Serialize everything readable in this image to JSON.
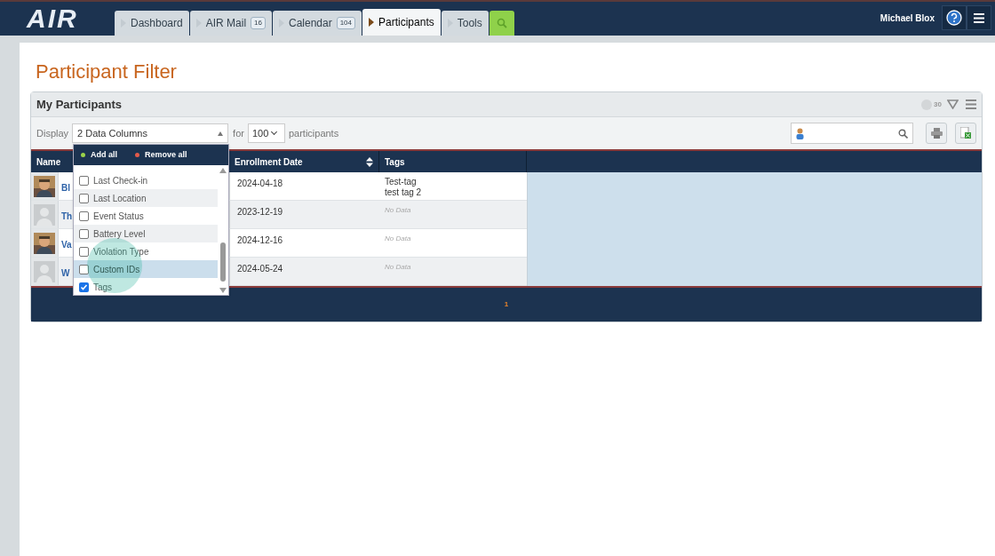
{
  "top_bar": {
    "logo": "AIR",
    "tabs": [
      {
        "label": "Dashboard",
        "selected": false
      },
      {
        "label": "AIR Mail",
        "badge": "16",
        "selected": false
      },
      {
        "label": "Calendar",
        "badge": "104",
        "selected": false
      },
      {
        "label": "Participants",
        "selected": true
      },
      {
        "label": "Tools",
        "selected": false
      }
    ],
    "user": "Michael Blox"
  },
  "page_title": "Participant Filter",
  "panel": {
    "title": "My Participants",
    "count": "30",
    "toolbar": {
      "display_label": "Display",
      "columns_select": "2 Data Columns",
      "for_label": "for",
      "per_page": "100",
      "per_page_label": "participants"
    },
    "columns_dropdown": {
      "actions": [
        {
          "label": "Add all",
          "kind": "add"
        },
        {
          "label": "Remove all",
          "kind": "remove"
        }
      ],
      "options": [
        {
          "label": "Last Check-in",
          "checked": false,
          "selected": false
        },
        {
          "label": "Last Location",
          "checked": false,
          "selected": false
        },
        {
          "label": "Event Status",
          "checked": false,
          "selected": false
        },
        {
          "label": "Battery Level",
          "checked": false,
          "selected": false
        },
        {
          "label": "Violation Type",
          "checked": false,
          "selected": false
        },
        {
          "label": "Custom IDs",
          "checked": false,
          "selected": true
        },
        {
          "label": "Tags",
          "checked": true,
          "selected": false
        }
      ]
    },
    "table": {
      "columns": [
        "Name",
        "Enrollment Date",
        "Tags"
      ],
      "rows": [
        {
          "photo": true,
          "name": "Bl",
          "date": "2024-04-18",
          "tags": [
            "Test-tag",
            "test tag 2"
          ]
        },
        {
          "photo": false,
          "name": "Th",
          "date": "2023-12-19",
          "no_data": "No Data"
        },
        {
          "photo": true,
          "name": "Va",
          "date": "2024-12-16",
          "no_data": "No Data"
        },
        {
          "photo": false,
          "name": "W",
          "date": "2024-05-24",
          "no_data": "No Data"
        }
      ]
    },
    "pagination": {
      "pages": [
        {
          "label": "1",
          "selected": true
        }
      ]
    }
  }
}
